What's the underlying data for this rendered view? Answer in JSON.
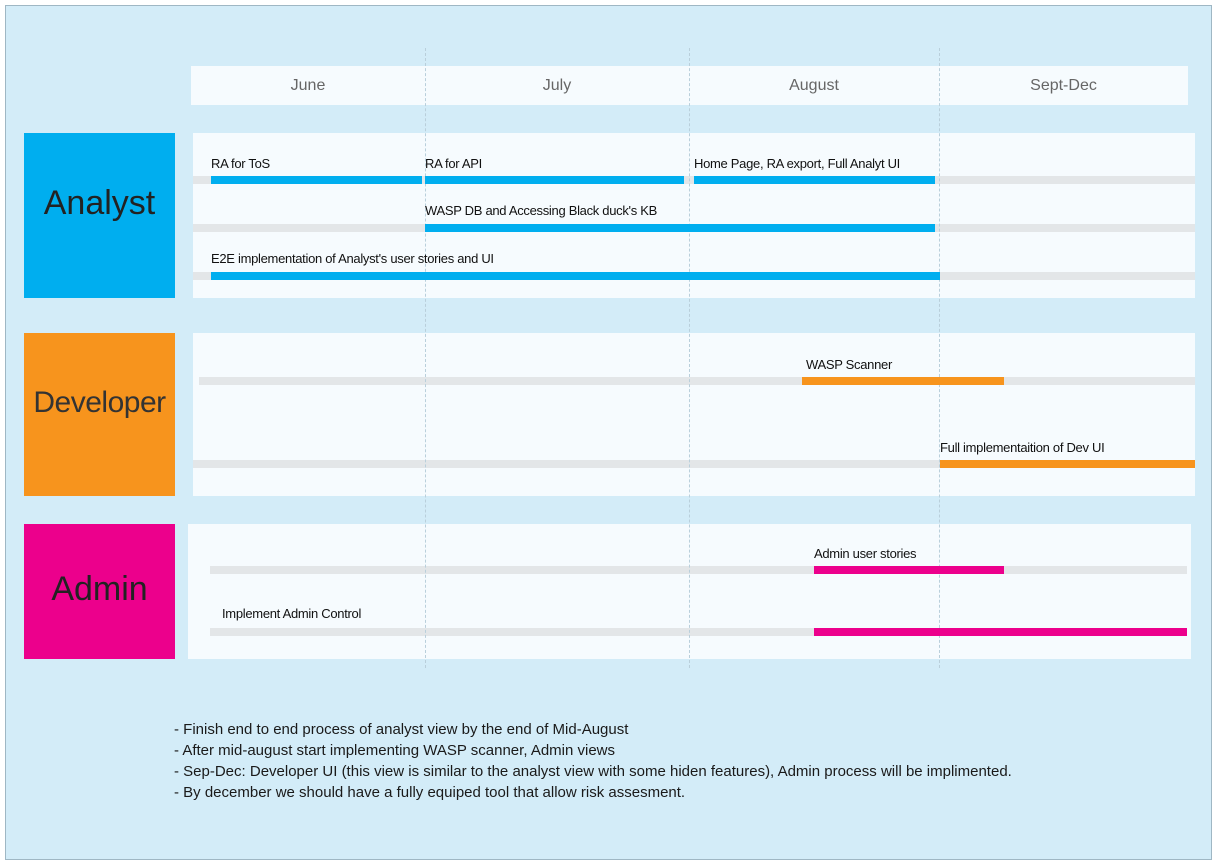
{
  "colors": {
    "analyst": "#00aeef",
    "developer": "#f7941d",
    "admin": "#ec008c",
    "track": "#e3e6e8",
    "background": "#d3ecf8"
  },
  "months": [
    "June",
    "July",
    "August",
    "Sept-Dec"
  ],
  "roles": {
    "analyst": {
      "label": "Analyst",
      "tasks": [
        {
          "label": "RA for ToS",
          "start": "June",
          "end": "June"
        },
        {
          "label": "RA for API",
          "start": "July",
          "end": "July"
        },
        {
          "label": "Home Page, RA export, Full Analyt UI",
          "start": "August",
          "end": "August"
        },
        {
          "label": "WASP DB and Accessing Black duck's KB",
          "start": "July",
          "end": "August"
        },
        {
          "label": "E2E implementation of  Analyst's user stories and UI",
          "start": "June",
          "end": "August"
        }
      ]
    },
    "developer": {
      "label": "Developer",
      "tasks": [
        {
          "label": "WASP Scanner",
          "start": "Mid-August",
          "end": "Early Sept-Dec"
        },
        {
          "label": "Full implementaition of Dev UI",
          "start": "Sept-Dec",
          "end": "Sept-Dec"
        }
      ]
    },
    "admin": {
      "label": "Admin",
      "tasks": [
        {
          "label": "Admin user stories",
          "start": "Mid-August",
          "end": "Early Sept-Dec"
        },
        {
          "label": "Implement Admin Control",
          "start": "Mid-August",
          "end": "Sept-Dec"
        }
      ]
    }
  },
  "notes": [
    "- Finish end to end process of  analyst view by the end of Mid-August",
    "- After mid-august start implementing WASP scanner, Admin views",
    "- Sep-Dec: Developer UI (this view is similar to the analyst view with some hiden features), Admin process  will be implimented.",
    "- By december we should have a fully equiped tool that allow risk assesment."
  ]
}
